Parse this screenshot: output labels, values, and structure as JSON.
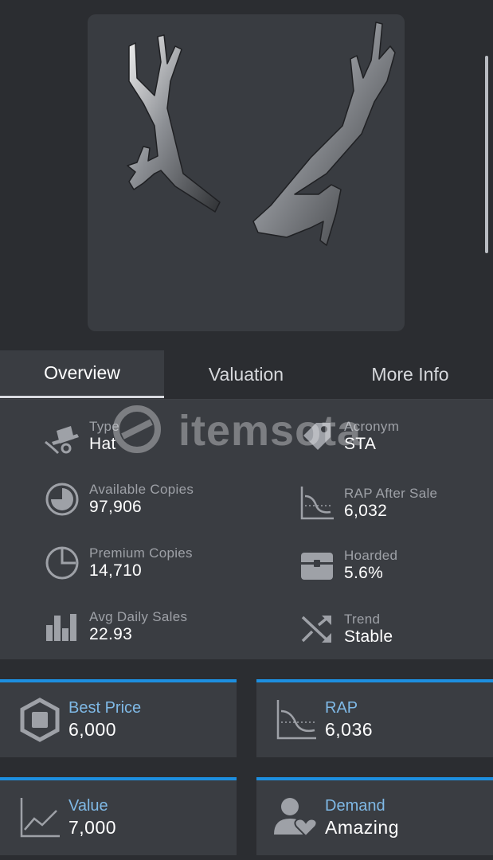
{
  "item": {
    "image_name": "antlers-item-image"
  },
  "tabs": [
    {
      "label": "Overview",
      "active": true
    },
    {
      "label": "Valuation",
      "active": false
    },
    {
      "label": "More Info",
      "active": false
    }
  ],
  "watermark": {
    "text": "itemsota"
  },
  "stats": {
    "type": {
      "label": "Type",
      "value": "Hat",
      "icon": "hat-icon"
    },
    "acronym": {
      "label": "Acronym",
      "value": "STA",
      "icon": "tag-icon"
    },
    "available_copies": {
      "label": "Available Copies",
      "value": "97,906",
      "icon": "pie-chart-icon"
    },
    "rap_after_sale": {
      "label": "RAP After Sale",
      "value": "6,032",
      "icon": "wave-chart-icon"
    },
    "premium_copies": {
      "label": "Premium Copies",
      "value": "14,710",
      "icon": "pie-outline-icon"
    },
    "hoarded": {
      "label": "Hoarded",
      "value": "5.6%",
      "icon": "chest-icon"
    },
    "avg_daily_sales": {
      "label": "Avg Daily Sales",
      "value": "22.93",
      "icon": "bar-chart-icon"
    },
    "trend": {
      "label": "Trend",
      "value": "Stable",
      "icon": "shuffle-icon"
    }
  },
  "cards": {
    "best_price": {
      "label": "Best Price",
      "value": "6,000",
      "icon": "robux-icon"
    },
    "rap": {
      "label": "RAP",
      "value": "6,036",
      "icon": "wave-chart-icon"
    },
    "value": {
      "label": "Value",
      "value": "7,000",
      "icon": "line-chart-icon"
    },
    "demand": {
      "label": "Demand",
      "value": "Amazing",
      "icon": "user-heart-icon"
    }
  },
  "colors": {
    "background": "#2b2d31",
    "panel": "#3a3d42",
    "accent": "#1d8fe0",
    "card_label": "#7fb9e6"
  }
}
